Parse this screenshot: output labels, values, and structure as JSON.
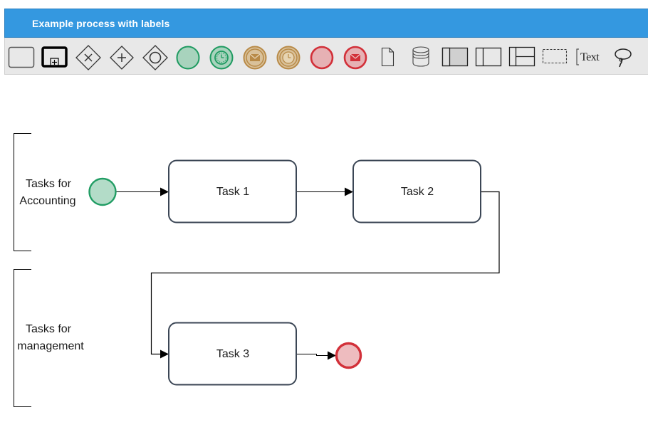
{
  "header": {
    "title": "Example process with labels"
  },
  "toolbar": {
    "tools": [
      {
        "name": "task",
        "icon": "task-icon"
      },
      {
        "name": "subprocess",
        "icon": "subprocess-icon"
      },
      {
        "name": "exclusive-gateway",
        "icon": "exclusive-gateway-icon"
      },
      {
        "name": "parallel-gateway",
        "icon": "parallel-gateway-icon"
      },
      {
        "name": "inclusive-gateway",
        "icon": "inclusive-gateway-icon"
      },
      {
        "name": "start-event",
        "icon": "start-event-icon"
      },
      {
        "name": "timer-start-event",
        "icon": "timer-start-event-icon"
      },
      {
        "name": "message-intermediate-event",
        "icon": "message-intermediate-event-icon"
      },
      {
        "name": "timer-intermediate-event",
        "icon": "timer-intermediate-event-icon"
      },
      {
        "name": "end-event",
        "icon": "end-event-icon"
      },
      {
        "name": "message-end-event",
        "icon": "message-end-event-icon"
      },
      {
        "name": "data-object",
        "icon": "data-object-icon"
      },
      {
        "name": "data-store",
        "icon": "data-store-icon"
      },
      {
        "name": "pool",
        "icon": "pool-icon"
      },
      {
        "name": "vertical-pool",
        "icon": "vertical-pool-icon"
      },
      {
        "name": "lane",
        "icon": "lane-icon"
      },
      {
        "name": "group",
        "icon": "group-icon"
      },
      {
        "name": "text-annotation",
        "icon": "text-annotation-icon",
        "label": "Text"
      },
      {
        "name": "lasso",
        "icon": "lasso-icon"
      }
    ]
  },
  "colors": {
    "header_bg": "#3498e0",
    "toolbar_bg": "#e8e8e8",
    "start_fill": "#b3dcc8",
    "start_stroke": "#219d64",
    "end_fill": "#eebcbf",
    "end_stroke": "#d23039",
    "intermediate_fill": "#c9a56a",
    "intermediate_stroke": "#b88a47",
    "task_stroke": "#3b4655"
  },
  "diagram": {
    "annotations": [
      {
        "id": "accounting",
        "label_line1": "Tasks for",
        "label_line2": "Accounting"
      },
      {
        "id": "management",
        "label_line1": "Tasks for",
        "label_line2": "management"
      }
    ],
    "tasks": [
      {
        "id": "task1",
        "label": "Task 1"
      },
      {
        "id": "task2",
        "label": "Task 2"
      },
      {
        "id": "task3",
        "label": "Task 3"
      }
    ],
    "events": [
      {
        "id": "start",
        "type": "start"
      },
      {
        "id": "end",
        "type": "end"
      }
    ],
    "flows": [
      {
        "from": "start",
        "to": "task1"
      },
      {
        "from": "task1",
        "to": "task2"
      },
      {
        "from": "task2",
        "to": "task3"
      },
      {
        "from": "task3",
        "to": "end"
      }
    ]
  }
}
